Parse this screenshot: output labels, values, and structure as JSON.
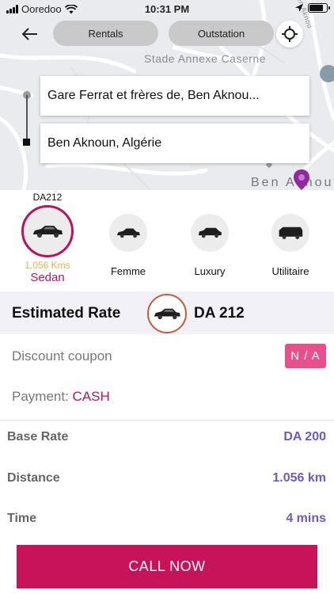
{
  "status_bar": {
    "carrier": "Ooredoo",
    "time": "10:31 PM"
  },
  "map": {
    "landmark_label": "Stade Annexe Caserne",
    "area_label": "Ben Aknou",
    "street_label": "Ben Aknou"
  },
  "header": {
    "back_icon": "arrow-left-icon",
    "rentals_label": "Rentals",
    "outstation_label": "Outstation",
    "locate_icon": "crosshair-icon"
  },
  "route": {
    "pickup": "Gare Ferrat et frères de, Ben Aknou...",
    "drop": "Ben Aknoun, Algérie"
  },
  "vehicles": [
    {
      "name": "Sedan",
      "price": "DA212",
      "distance": "1.056 Kms",
      "selected": true
    },
    {
      "name": "Femme",
      "selected": false
    },
    {
      "name": "Luxury",
      "selected": false
    },
    {
      "name": "Utilitaire",
      "selected": false
    }
  ],
  "estimate": {
    "label": "Estimated Rate",
    "amount": "DA 212"
  },
  "coupon": {
    "label": "Discount coupon",
    "value": "N / A"
  },
  "payment": {
    "label": "Payment:",
    "method": "CASH"
  },
  "fare": {
    "base_label": "Base Rate",
    "base_value": "DA 200",
    "distance_label": "Distance",
    "distance_value": "1.056 km",
    "time_label": "Time",
    "time_value": "4 mins"
  },
  "cta": {
    "label": "CALL NOW"
  },
  "colors": {
    "accent": "#C8135A",
    "value_purple": "#6A5BC7",
    "coupon_pink": "#E7508A",
    "kms_yellow": "#E8B04A"
  }
}
